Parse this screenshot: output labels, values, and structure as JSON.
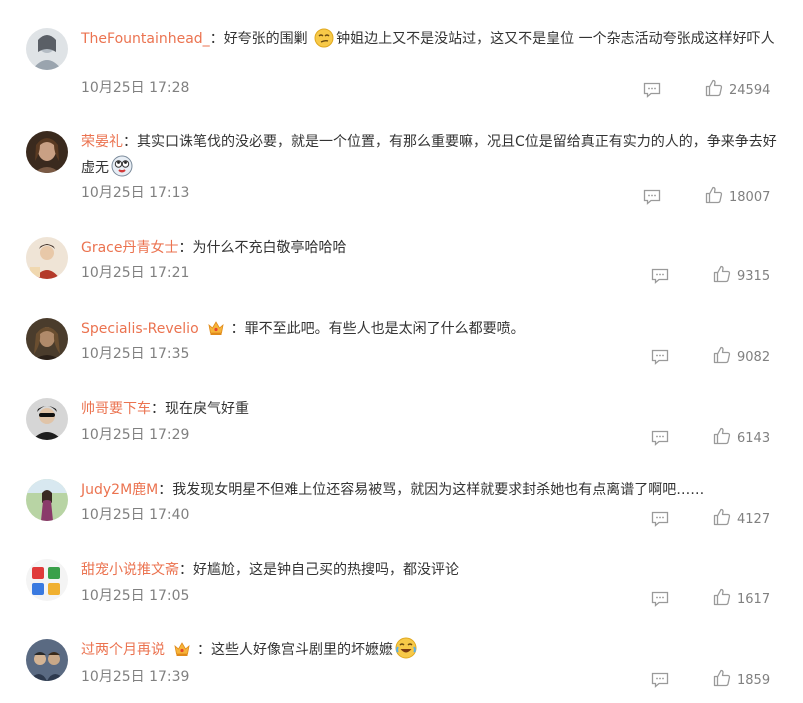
{
  "comments": [
    {
      "username": "TheFountainhead_",
      "sep": "：",
      "text_parts": [
        "好夸张的围剿",
        "钟姐边上又不是没站过，这又不是皇位 一个杂志活动夸张成这样好吓人"
      ],
      "emoji": "smirk-face-emoji",
      "time": "10月25日 17:28",
      "likes": "24594",
      "avatar_colors": [
        "#d8dce0",
        "#a0a8b0"
      ]
    },
    {
      "username": "荣晏礼",
      "sep": "：",
      "text_parts": [
        "其实口诛笔伐的没必要，就是一个位置，有那么重要嘛，况且C位是留给真正有实力的人的，争来争去好虚无",
        ""
      ],
      "emoji": "rolling-eyes-emoji",
      "time": "10月25日 17:13",
      "likes": "18007",
      "avatar_colors": [
        "#6b4a36",
        "#2a1c14"
      ]
    },
    {
      "username": "Grace丹青女士",
      "sep": "：",
      "text_parts": [
        "为什么不充白敬亭哈哈哈"
      ],
      "time": "10月25日 17:21",
      "likes": "9315",
      "avatar_colors": [
        "#e8d0b8",
        "#a83a2a"
      ]
    },
    {
      "username": "Specialis-Revelio",
      "sep": "：",
      "text_parts": [
        "罪不至此吧。有些人也是太闲了什么都要喷。"
      ],
      "crown": true,
      "time": "10月25日 17:35",
      "likes": "9082",
      "avatar_colors": [
        "#7a6650",
        "#3a2e22"
      ]
    },
    {
      "username": "帅哥要下车",
      "sep": "：",
      "text_parts": [
        "现在戾气好重"
      ],
      "time": "10月25日 17:29",
      "likes": "6143",
      "avatar_colors": [
        "#cfcfcf",
        "#222222"
      ]
    },
    {
      "username": "Judy2M鹿M",
      "sep": "：",
      "text_parts": [
        "我发现女明星不但难上位还容易被骂，就因为这样就要求封杀她也有点离谱了啊吧……"
      ],
      "time": "10月25日 17:40",
      "likes": "4127",
      "avatar_colors": [
        "#a8c890",
        "#5a7a4a"
      ]
    },
    {
      "username": "甜宠小说推文斋",
      "sep": "：",
      "text_parts": [
        "好尴尬，这是钟自己买的热搜吗，都没评论"
      ],
      "time": "10月25日 17:05",
      "likes": "1617",
      "avatar_colors": [
        "#f2f2f2",
        "#3aa04a"
      ]
    },
    {
      "username": "过两个月再说",
      "sep": "：",
      "text_parts": [
        "这些人好像宫斗剧里的坏嬷嬷",
        ""
      ],
      "crown": true,
      "emoji": "laughing-tears-emoji",
      "time": "10月25日 17:39",
      "likes": "1859",
      "avatar_colors": [
        "#6a7f9a",
        "#2a3344"
      ]
    }
  ],
  "icons": {
    "reply": "comment-bubble-icon",
    "like": "thumbs-up-icon",
    "crown": "vip-crown-icon"
  },
  "colors": {
    "username": "#eb7350",
    "text": "#333333",
    "meta": "#808080"
  }
}
